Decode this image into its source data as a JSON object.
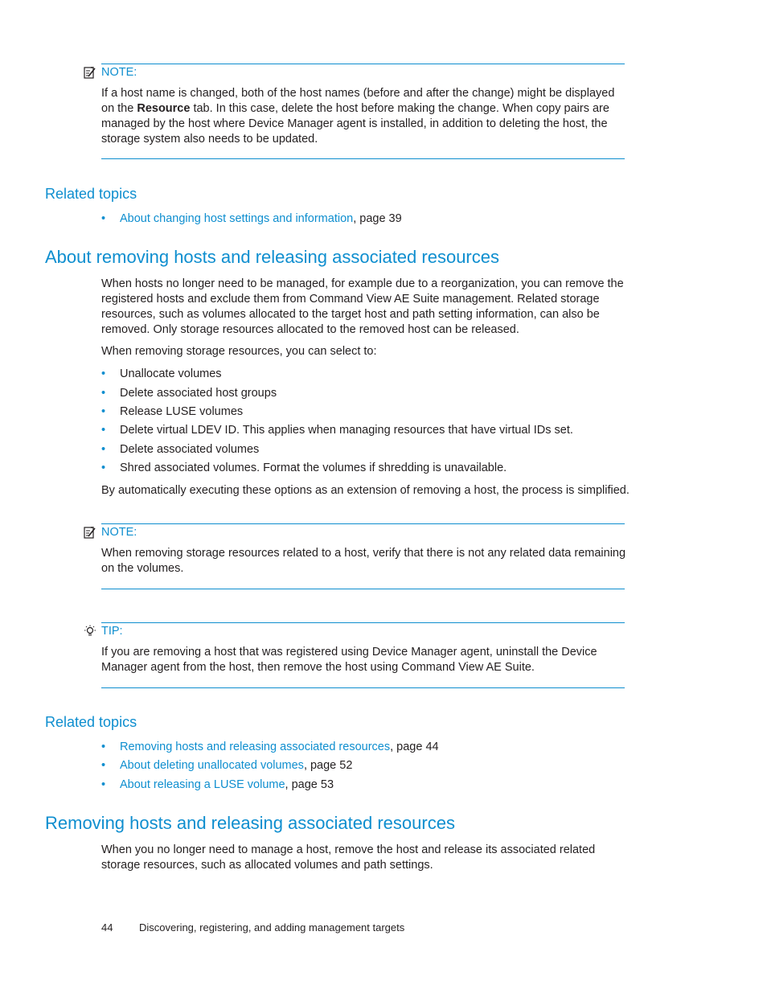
{
  "note1": {
    "label": "NOTE:",
    "text_pre": "If a host name is changed, both of the host names (before and after the change) might be displayed on the ",
    "bold": "Resource",
    "text_post": " tab. In this case, delete the host before making the change. When copy pairs are managed by the host where Device Manager agent is installed, in addition to deleting the host, the storage system also needs to be updated."
  },
  "related1": {
    "heading": "Related topics",
    "items": [
      {
        "link": "About changing host settings and information",
        "suffix": ", page 39"
      }
    ]
  },
  "section1": {
    "title": "About removing hosts and releasing associated resources",
    "para1": "When hosts no longer need to be managed, for example due to a reorganization, you can remove the registered hosts and exclude them from Command View AE Suite management. Related storage resources, such as volumes allocated to the target host and path setting information, can also be removed. Only storage resources allocated to the removed host can be released.",
    "para2": "When removing storage resources, you can select to:",
    "bullets": [
      "Unallocate volumes",
      "Delete associated host groups",
      "Release LUSE volumes",
      "Delete virtual LDEV ID. This applies when managing resources that have virtual IDs set.",
      "Delete associated volumes",
      "Shred associated volumes. Format the volumes if shredding is unavailable."
    ],
    "para3": "By automatically executing these options as an extension of removing a host, the process is simplified."
  },
  "note2": {
    "label": "NOTE:",
    "text": "When removing storage resources related to a host, verify that there is not any related data remaining on the volumes."
  },
  "tip": {
    "label": "TIP:",
    "text": "If you are removing a host that was registered using Device Manager agent, uninstall the Device Manager agent from the host, then remove the host using Command View AE Suite."
  },
  "related2": {
    "heading": "Related topics",
    "items": [
      {
        "link": "Removing hosts and releasing associated resources",
        "suffix": ", page 44"
      },
      {
        "link": "About deleting unallocated volumes",
        "suffix": ", page 52"
      },
      {
        "link": "About releasing a LUSE volume",
        "suffix": ", page 53"
      }
    ]
  },
  "section2": {
    "title": "Removing hosts and releasing associated resources",
    "para": "When you no longer need to manage a host, remove the host and release its associated related storage resources, such as allocated volumes and path settings."
  },
  "footer": {
    "page_number": "44",
    "chapter": "Discovering, registering, and adding management targets"
  }
}
